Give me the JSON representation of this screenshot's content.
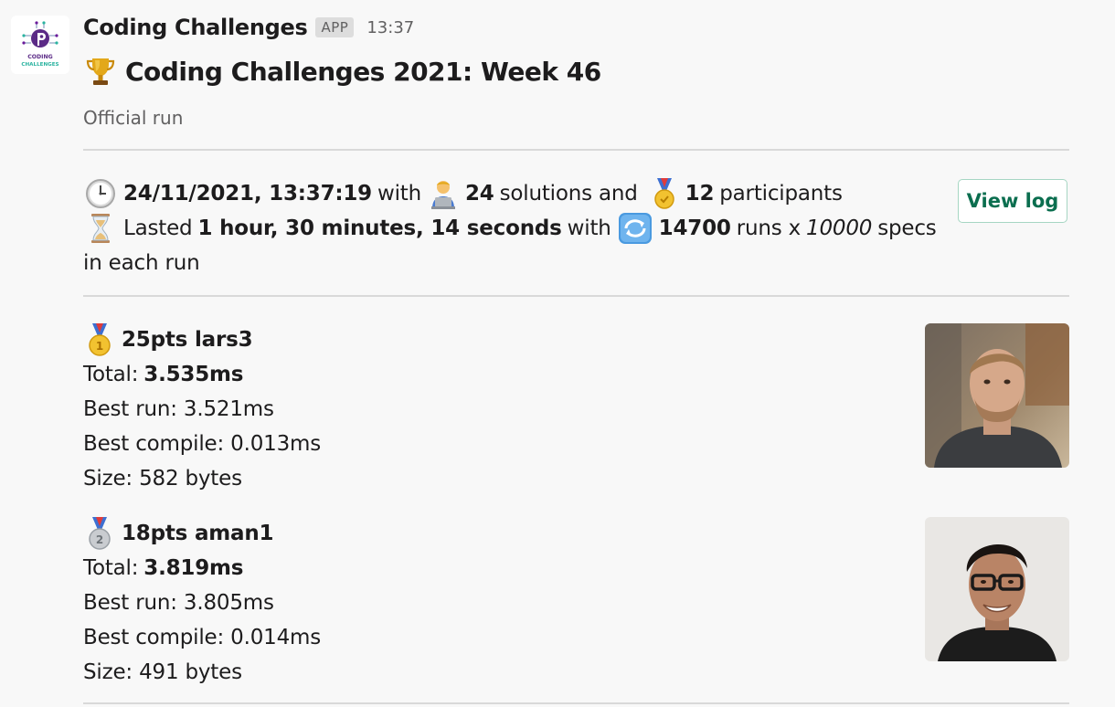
{
  "app": {
    "name": "Coding Challenges",
    "badge": "APP",
    "time": "13:37",
    "logo_text_line1": "CODING",
    "logo_text_line2": "CHALLENGES"
  },
  "message": {
    "title": "Coding Challenges 2021: Week 46",
    "subtitle": "Official run"
  },
  "stats": {
    "date": "24/11/2021, 13:37:19",
    "with1": "with",
    "solutions_count": "24",
    "solutions_text": "solutions and",
    "participants_count": "12",
    "participants_text": "participants",
    "lasted_label": "Lasted",
    "duration": "1 hour, 30 minutes, 14 seconds",
    "with2": "with",
    "runs_count": "14700",
    "runs_x": "runs x",
    "specs_count": "10000",
    "specs_text": "specs",
    "in_each_run": "in each run"
  },
  "buttons": {
    "view_log": "View log"
  },
  "entries": [
    {
      "medal": "gold-medal-icon",
      "header": "25pts lars3",
      "total_label": "Total:",
      "total_value": "3.535ms",
      "best_run": "Best run: 3.521ms",
      "best_compile": "Best compile: 0.013ms",
      "size": "Size: 582 bytes"
    },
    {
      "medal": "silver-medal-icon",
      "header": "18pts aman1",
      "total_label": "Total:",
      "total_value": "3.819ms",
      "best_run": "Best run: 3.805ms",
      "best_compile": "Best compile: 0.014ms",
      "size": "Size: 491 bytes"
    }
  ],
  "colors": {
    "background": "#f8f8f8",
    "button_text": "#0b6e4f",
    "button_border": "#a6d6c3",
    "divider": "#d9d9d9",
    "muted": "#616061",
    "logo_purple": "#6a1b9a",
    "logo_teal": "#2bb3a0"
  }
}
